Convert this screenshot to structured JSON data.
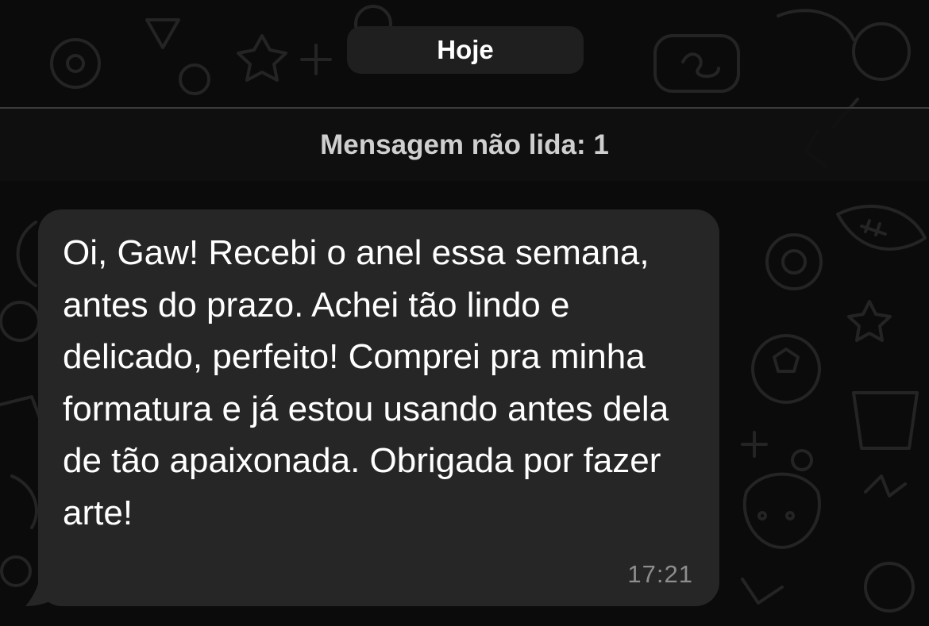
{
  "chat": {
    "date_label": "Hoje",
    "unread_label": "Mensagem não lida: 1"
  },
  "message": {
    "text": "Oi, Gaw! Recebi o anel essa semana, antes do prazo. Achei tão lindo e delicado, perfeito! Comprei pra minha formatura e já estou usando antes dela de tão apaixonada. Obrigada por fazer arte!",
    "time": "17:21"
  },
  "colors": {
    "background": "#0b0b0b",
    "bubble": "#262626",
    "date_pill": "#1f1f1f",
    "text_primary": "#ffffff",
    "text_muted": "#8d8d8d"
  }
}
